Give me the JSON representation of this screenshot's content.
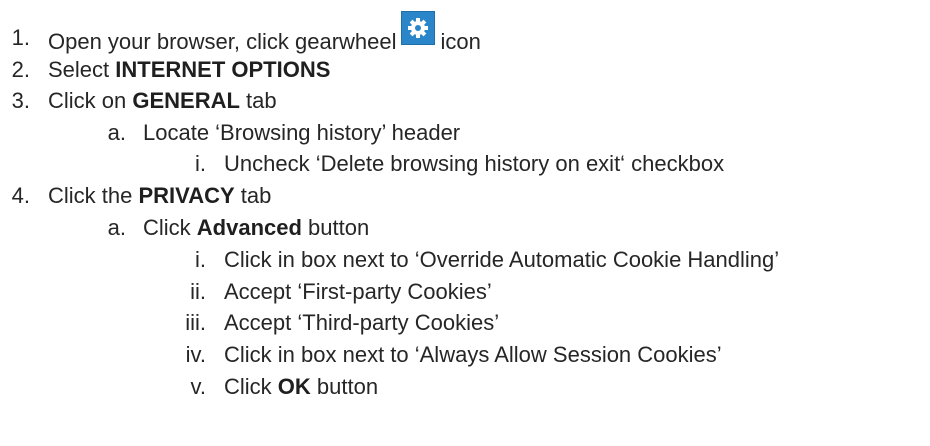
{
  "steps": [
    {
      "marker": "1.",
      "before": "Open your browser, click gearwheel",
      "after": "icon"
    },
    {
      "marker": "2.",
      "before": "Select ",
      "bold": "INTERNET OPTIONS",
      "after": ""
    },
    {
      "marker": "3.",
      "before": "Click on ",
      "bold": "GENERAL",
      "after": " tab"
    },
    {
      "marker": "a.",
      "text": "Locate ‘Browsing history’ header"
    },
    {
      "marker": "i.",
      "text": "Uncheck  ‘Delete browsing history on exit‘ checkbox"
    },
    {
      "marker": "4.",
      "before": "Click the ",
      "bold": "PRIVACY",
      "after": " tab"
    },
    {
      "marker": "a.",
      "before": "Click ",
      "bold": "Advanced",
      "after": " button"
    },
    {
      "marker": "i.",
      "text": "Click in box next to ‘Override Automatic Cookie Handling’"
    },
    {
      "marker": "ii.",
      "text": "Accept ‘First-party Cookies’"
    },
    {
      "marker": "iii.",
      "text": "Accept ‘Third-party Cookies’"
    },
    {
      "marker": "iv.",
      "text": "Click in box next to ‘Always Allow Session Cookies’"
    },
    {
      "marker": "v.",
      "before": "Click ",
      "bold": "OK",
      "after": " button"
    }
  ],
  "icons": {
    "gear": "gear-icon",
    "gear_color": "#2a86c8"
  }
}
